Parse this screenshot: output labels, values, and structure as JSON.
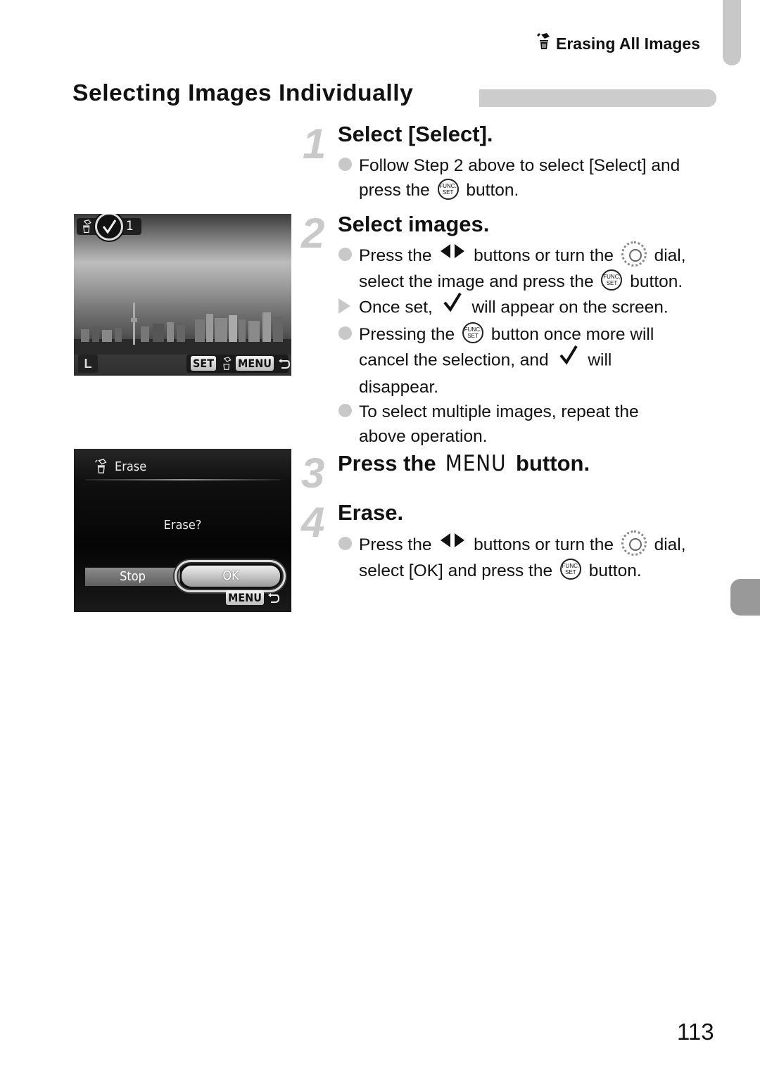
{
  "running_head": {
    "icon": "erase-icon",
    "text": "Erasing All Images"
  },
  "section_title": "Selecting Images Individually",
  "steps": [
    {
      "number": "1",
      "title": "Select [Select].",
      "items": [
        {
          "type": "bullet",
          "parts": [
            "Follow Step 2 above to select [Select] and",
            "press the",
            "button."
          ]
        }
      ]
    },
    {
      "number": "2",
      "title": "Select images.",
      "items": [
        {
          "type": "bullet",
          "parts": [
            "Press the",
            "buttons or turn the",
            "dial,",
            "select the image and press the",
            "button."
          ]
        },
        {
          "type": "result",
          "parts": [
            "Once set,",
            "will appear on the screen."
          ]
        },
        {
          "type": "bullet",
          "parts": [
            "Pressing the",
            "button once more will",
            "cancel the selection, and",
            "will",
            "disappear."
          ]
        },
        {
          "type": "bullet",
          "parts": [
            "To select multiple images, repeat the",
            "above operation."
          ]
        }
      ]
    },
    {
      "number": "3",
      "title_prefix": "Press the",
      "title_menu": "MENU",
      "title_suffix": "button."
    },
    {
      "number": "4",
      "title": "Erase.",
      "items": [
        {
          "type": "bullet",
          "parts": [
            "Press the",
            "buttons or turn the",
            "dial,",
            "select [OK] and press the",
            "button."
          ]
        }
      ]
    }
  ],
  "icons": {
    "func_top": "FUNC.",
    "func_bottom": "SET"
  },
  "screen1": {
    "count": "1",
    "size_label": "L",
    "set_label": "SET",
    "menu_label": "MENU"
  },
  "screen2": {
    "title": "Erase",
    "question": "Erase?",
    "stop_label": "Stop",
    "ok_label": "OK",
    "menu_label": "MENU"
  },
  "page_number": "113",
  "colors": {
    "step_number": "#c9c9c9",
    "bullet": "#c8c8c8",
    "section_bar": "#cccccc",
    "edge_tab": "#999999"
  }
}
